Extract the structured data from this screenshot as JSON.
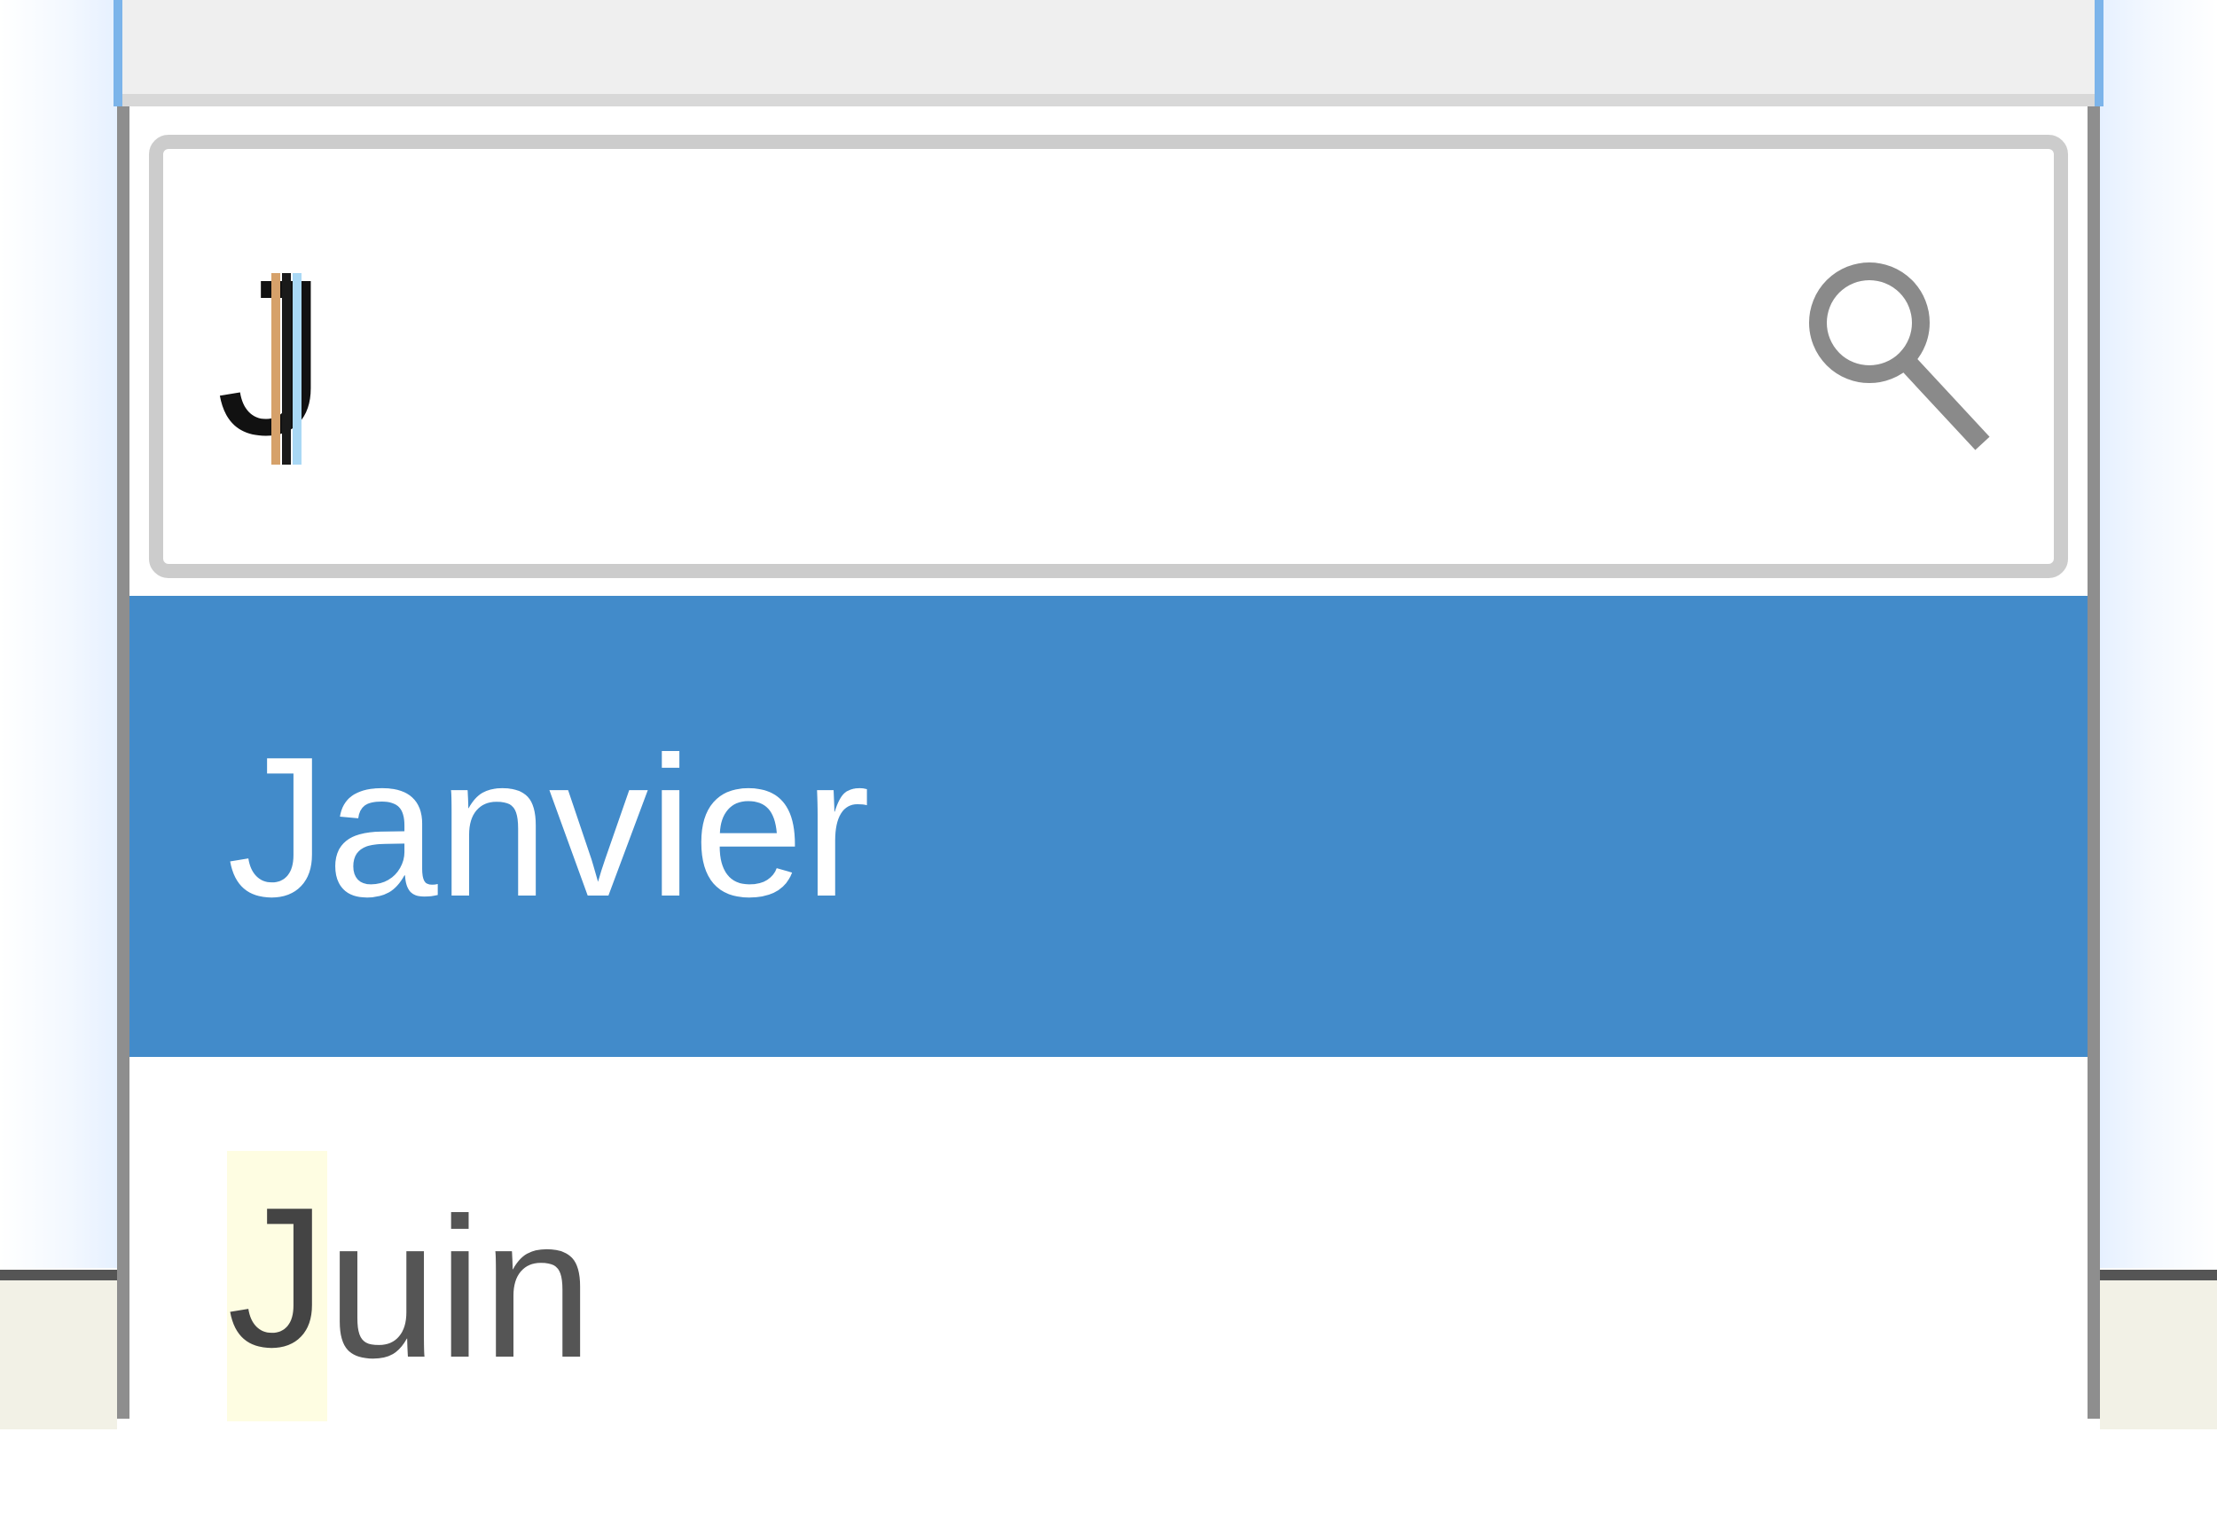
{
  "search": {
    "value": "J",
    "placeholder": ""
  },
  "options": [
    {
      "match": "J",
      "rest": "anvier",
      "highlighted": true
    },
    {
      "match": "J",
      "rest": "uin",
      "highlighted": false
    }
  ],
  "colors": {
    "highlight": "#428bca",
    "match_highlight": "#fefde2",
    "border": "#8e8e8e",
    "focus": "#7cb4ea"
  }
}
